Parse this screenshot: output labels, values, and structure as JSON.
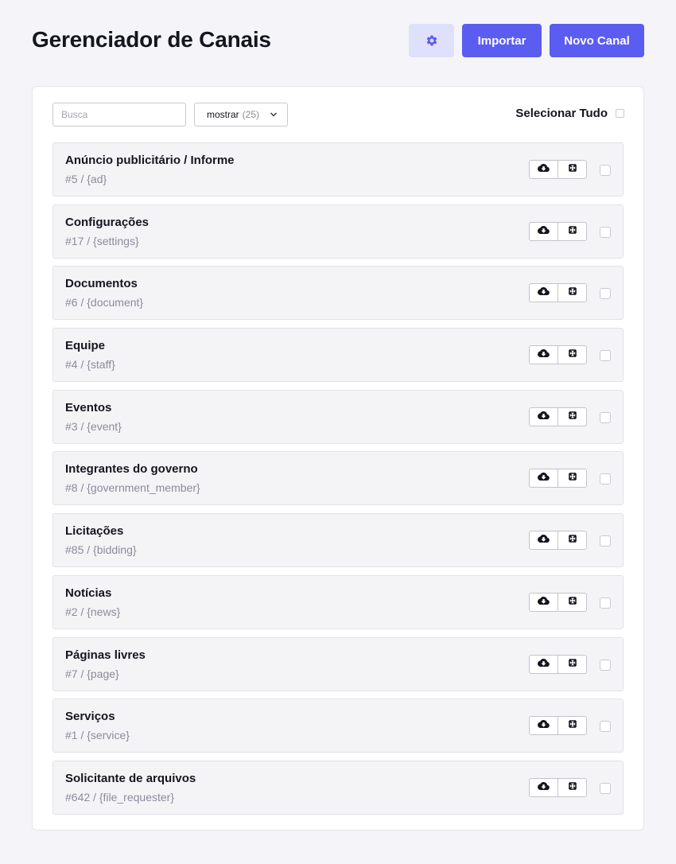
{
  "header": {
    "title": "Gerenciador de Canais",
    "settings_icon": "gear-icon",
    "import_label": "Importar",
    "new_channel_label": "Novo Canal"
  },
  "toolbar": {
    "search_placeholder": "Busca",
    "show_label": "mostrar",
    "show_count": "(25)",
    "select_all_label": "Selecionar Tudo"
  },
  "colors": {
    "accent": "#5b5cf0",
    "accent_light": "#dfe0fb",
    "background": "#f4f4f9",
    "muted_text": "#8b8b9a"
  },
  "channels": [
    {
      "name": "Anúncio publicitário / Informe",
      "meta": "#5 / {ad}"
    },
    {
      "name": "Configurações",
      "meta": "#17 / {settings}"
    },
    {
      "name": "Documentos",
      "meta": "#6 / {document}"
    },
    {
      "name": "Equipe",
      "meta": "#4 / {staff}"
    },
    {
      "name": "Eventos",
      "meta": "#3 / {event}"
    },
    {
      "name": "Integrantes do governo",
      "meta": "#8 / {government_member}"
    },
    {
      "name": "Licitações",
      "meta": "#85 / {bidding}"
    },
    {
      "name": "Notícias",
      "meta": "#2 / {news}"
    },
    {
      "name": "Páginas livres",
      "meta": "#7 / {page}"
    },
    {
      "name": "Serviços",
      "meta": "#1 / {service}"
    },
    {
      "name": "Solicitante de arquivos",
      "meta": "#642 / {file_requester}"
    }
  ],
  "row_action_icons": [
    "cloud-download-icon",
    "crop-icon"
  ]
}
